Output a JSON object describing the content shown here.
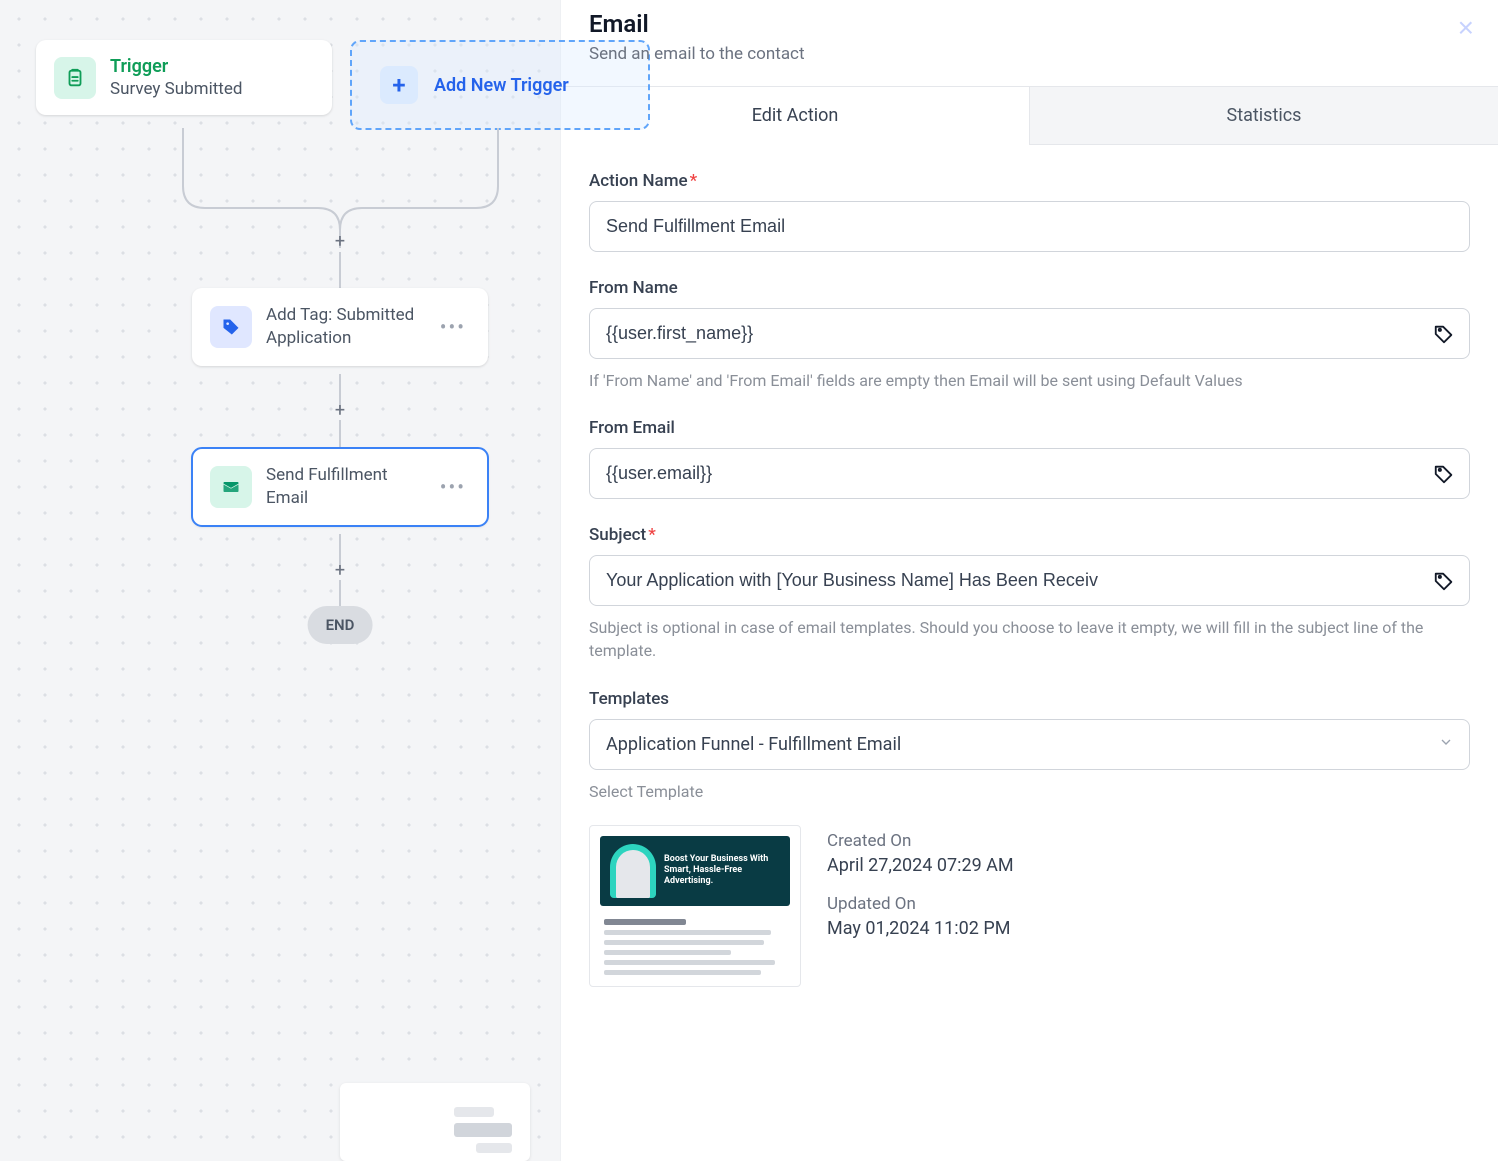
{
  "canvas": {
    "trigger": {
      "title": "Trigger",
      "subtitle": "Survey Submitted"
    },
    "add_trigger_label": "Add New Trigger",
    "nodes": {
      "tag": {
        "label": "Add Tag: Submitted Application"
      },
      "email": {
        "label": "Send Fulfillment Email"
      }
    },
    "end_label": "END"
  },
  "panel": {
    "title": "Email",
    "subtitle": "Send an email to the contact",
    "tabs": {
      "edit": "Edit Action",
      "stats": "Statistics"
    },
    "fields": {
      "action_name": {
        "label": "Action Name",
        "value": "Send Fulfillment Email"
      },
      "from_name": {
        "label": "From Name",
        "value": "{{user.first_name}}",
        "help": "If 'From Name' and 'From Email' fields are empty then Email will be sent using Default Values"
      },
      "from_email": {
        "label": "From Email",
        "value": "{{user.email}}"
      },
      "subject": {
        "label": "Subject",
        "value": "Your Application with [Your Business Name] Has Been Receiv",
        "help": "Subject is optional in case of email templates. Should you choose to leave it empty, we will fill in the subject line of the template."
      },
      "templates": {
        "label": "Templates",
        "selected": "Application Funnel - Fulfillment Email",
        "help": "Select Template",
        "hero_tagline": "Boost Your Business With Smart, Hassle-Free Advertising.",
        "created_label": "Created On",
        "created_value": "April 27,2024 07:29 AM",
        "updated_label": "Updated On",
        "updated_value": "May 01,2024 11:02 PM"
      }
    }
  }
}
